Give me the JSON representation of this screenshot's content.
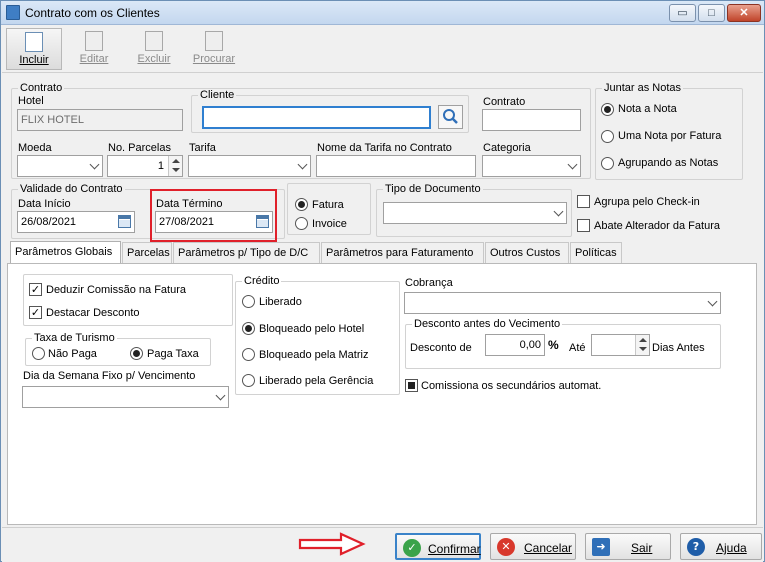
{
  "window": {
    "title": "Contrato com os Clientes",
    "minimize": "▭",
    "maximize": "□",
    "close": "✕"
  },
  "toolbar": {
    "incluir": "Incluir",
    "editar": "Editar",
    "excluir": "Excluir",
    "procurar": "Procurar"
  },
  "contrato": {
    "group": "Contrato",
    "hotel_label": "Hotel",
    "hotel_value": "FLIX HOTEL",
    "cliente_label": "Cliente",
    "cliente_value": "",
    "contrato_label": "Contrato",
    "contrato_value": ""
  },
  "juntar": {
    "group": "Juntar as Notas",
    "opt1": "Nota a Nota",
    "opt2": "Uma Nota por Fatura",
    "opt3": "Agrupando as Notas"
  },
  "row2": {
    "moeda_label": "Moeda",
    "moeda_value": "",
    "parcelas_label": "No. Parcelas",
    "parcelas_value": "1",
    "tarifa_label": "Tarifa",
    "tarifa_value": "",
    "nome_tarifa_label": "Nome da Tarifa no Contrato",
    "nome_tarifa_value": "",
    "categoria_label": "Categoria",
    "categoria_value": ""
  },
  "validade": {
    "group": "Validade do Contrato",
    "inicio_label": "Data Início",
    "inicio_value": "26/08/2021",
    "termino_label": "Data Término",
    "termino_value": "27/08/2021"
  },
  "fatura_opts": {
    "fatura": "Fatura",
    "invoice": "Invoice"
  },
  "tipo_doc": {
    "group": "Tipo de Documento",
    "value": ""
  },
  "checks": {
    "agrupa": "Agrupa pelo Check-in",
    "abate": "Abate Alterador da Fatura"
  },
  "tabs": [
    "Parâmetros Globais",
    "Parcelas",
    "Parâmetros p/ Tipo de D/C",
    "Parâmetros para Faturamento",
    "Outros Custos",
    "Políticas"
  ],
  "panel": {
    "deduzir": "Deduzir Comissão na Fatura",
    "destacar": "Destacar Desconto",
    "taxa_group": "Taxa de Turismo",
    "nao_paga": "Não Paga",
    "paga_taxa": "Paga Taxa",
    "dia_label": "Dia da Semana Fixo p/ Vencimento",
    "dia_value": "",
    "credito_group": "Crédito",
    "c1": "Liberado",
    "c2": "Bloqueado pelo Hotel",
    "c3": "Bloqueado pela Matriz",
    "c4": "Liberado pela Gerência",
    "cobranca_label": "Cobrança",
    "cobranca_value": "",
    "desc_group": "Desconto antes do Vecimento",
    "desc_label": "Desconto de",
    "desc_value": "0,00",
    "percent": "%",
    "ate": "Até",
    "ate_value": "",
    "dias": "Dias Antes",
    "comissiona": "Comissiona os secundários automat."
  },
  "buttons": {
    "confirmar": "Confirmar",
    "cancelar": "Cancelar",
    "sair": "Sair",
    "ajuda": "Ajuda"
  },
  "colors": {
    "highlight": "#e0202a",
    "arrow": "#e0202a",
    "confirm": "#3aa34a",
    "cancel": "#d8382c",
    "exit": "#2f6fb8",
    "help": "#1f5da8"
  }
}
